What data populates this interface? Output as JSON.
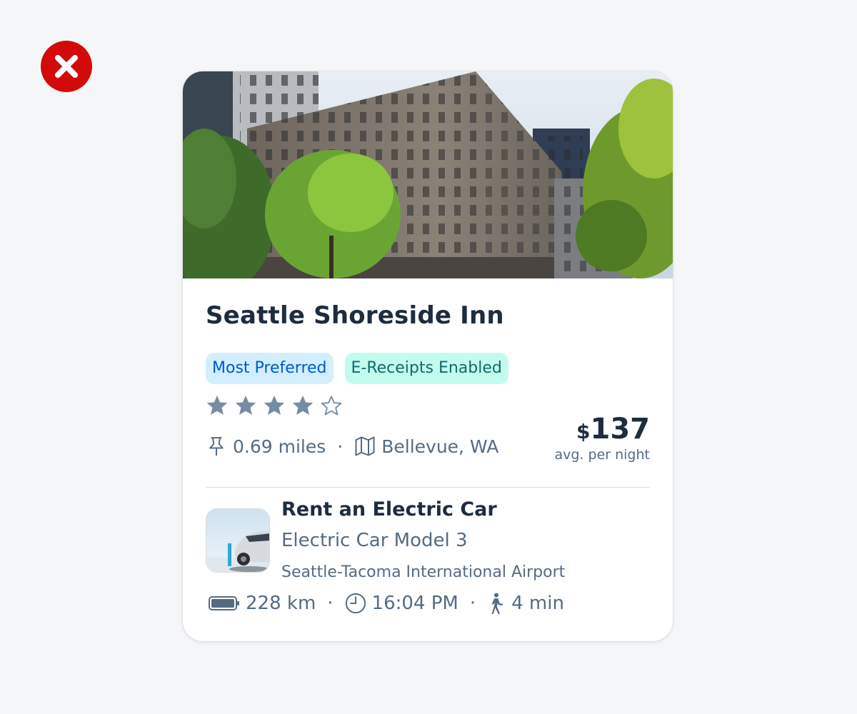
{
  "status": {
    "icon": "error-circle-icon",
    "color": "#d20a0a"
  },
  "card": {
    "image": {
      "alt": "hotel-building-photo"
    },
    "title": "Seattle Shoreside Inn",
    "tags": [
      {
        "label": "Most Preferred",
        "bg": "#d1efff",
        "fg": "#0057d2"
      },
      {
        "label": "E-Receipts Enabled",
        "bg": "#c2fcee",
        "fg": "#0f6b6b"
      }
    ],
    "rating": {
      "value": 4,
      "max": 5
    },
    "distance": "0.69 miles",
    "separator": "·",
    "location": "Bellevue, WA",
    "price": {
      "currency": "$",
      "amount": "137",
      "caption": "avg. per night"
    },
    "car": {
      "heading": "Rent an Electric Car",
      "model": "Electric Car Model 3",
      "pickup": "Seattle-Tacoma International Airport",
      "range": "228 km",
      "time": "16:04 PM",
      "walk": "4 min"
    }
  },
  "colors": {
    "text_primary": "#1d2d3e",
    "text_secondary": "#556b82",
    "star": "#758ca4",
    "divider": "#d9dde2",
    "background": "#f5f6f7"
  }
}
